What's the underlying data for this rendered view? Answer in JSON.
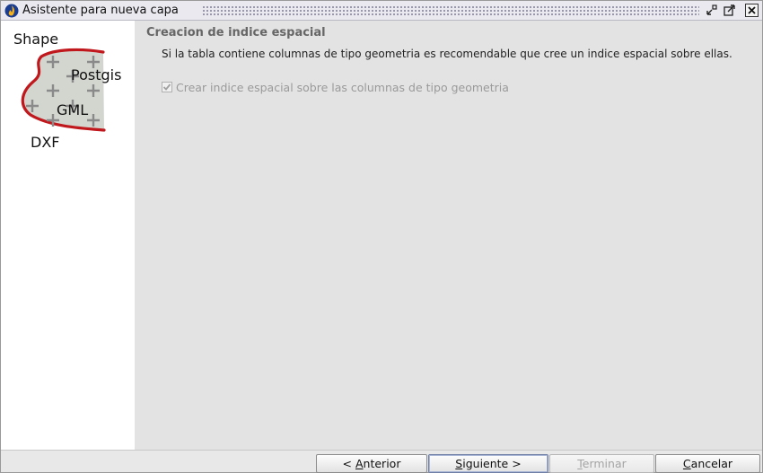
{
  "window": {
    "title": "Asistente para nueva capa",
    "icons": {
      "app": "gvsig-flame-icon",
      "minimize": "restore-down-icon",
      "maximize": "maximize-icon",
      "close": "close-icon"
    }
  },
  "side_panel": {
    "formats": {
      "shape": "Shape",
      "postgis": "Postgis",
      "gml": "GML",
      "dxf": "DXF"
    },
    "colors": {
      "outline": "#c0181c",
      "fill": "#d3d6cf",
      "cross": "#8a8a8a"
    }
  },
  "content": {
    "section_title": "Creacion de indice espacial",
    "description": "Si la tabla contiene columnas de tipo geometria es recomendable que cree un indice espacial sobre ellas.",
    "checkbox": {
      "label": "Crear indice espacial sobre las columnas de tipo geometria",
      "checked": true,
      "enabled": false
    }
  },
  "buttons": {
    "prev": {
      "pre": "< ",
      "mnemonic": "A",
      "rest": "nterior"
    },
    "next": {
      "pre": "",
      "mnemonic": "S",
      "rest": "iguiente >"
    },
    "finish": {
      "pre": "",
      "mnemonic": "T",
      "rest": "erminar",
      "enabled": false
    },
    "cancel": {
      "pre": "",
      "mnemonic": "C",
      "rest": "ancelar"
    }
  }
}
